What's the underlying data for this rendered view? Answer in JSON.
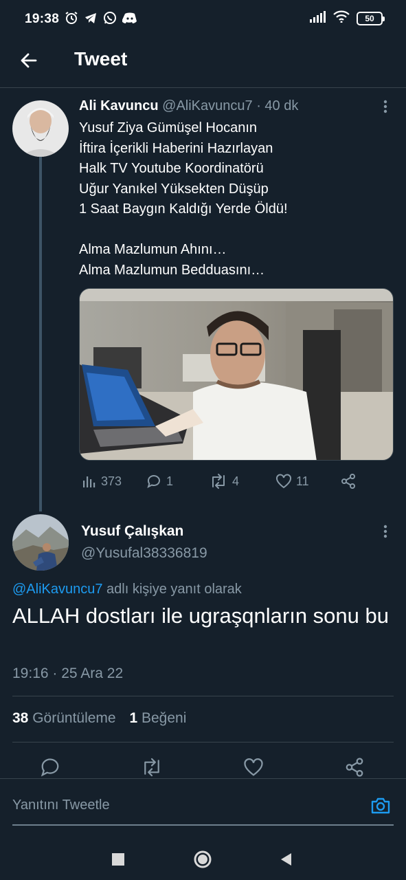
{
  "status_bar": {
    "time": "19:38",
    "battery": "50",
    "left_icons": [
      "alarm-icon",
      "telegram-icon",
      "whatsapp-icon",
      "discord-icon"
    ],
    "right_icons": [
      "signal-icon",
      "wifi-icon",
      "battery-icon"
    ]
  },
  "header": {
    "title": "Tweet"
  },
  "tweet": {
    "author_name": "Ali Kavuncu",
    "author_handle": "@AliKavuncu7",
    "separator": "·",
    "time_ago": "40 dk",
    "text": "Yusuf Ziya Gümüşel Hocanın\nİftira İçerikli Haberini Hazırlayan\nHalk TV Youtube Koordinatörü\nUğur Yanıkel Yüksekten Düşüp\n1 Saat Baygın Kaldığı Yerde Öldü!\n\nAlma Mazlumun Ahını…\nAlma Mazlumun Bedduasını…",
    "views": "373",
    "replies": "1",
    "retweets": "4",
    "likes": "11"
  },
  "reply": {
    "author_name": "Yusuf Çalışkan",
    "author_handle": "@Yusufal38336819",
    "reply_to_handle": "@AliKavuncu7",
    "reply_to_suffix": "adlı kişiye yanıt olarak",
    "text": "ALLAH dostları ile ugraşqnların sonu bu",
    "timestamp": "19:16 · 25 Ara 22",
    "view_count": "38",
    "view_label": "Görüntüleme",
    "like_count": "1",
    "like_label": "Beğeni"
  },
  "composer": {
    "placeholder": "Yanıtını Tweetle"
  },
  "colors": {
    "background": "#15202b",
    "accent": "#1d9bf0",
    "muted_text": "#8899a6",
    "divider": "#38444d"
  }
}
